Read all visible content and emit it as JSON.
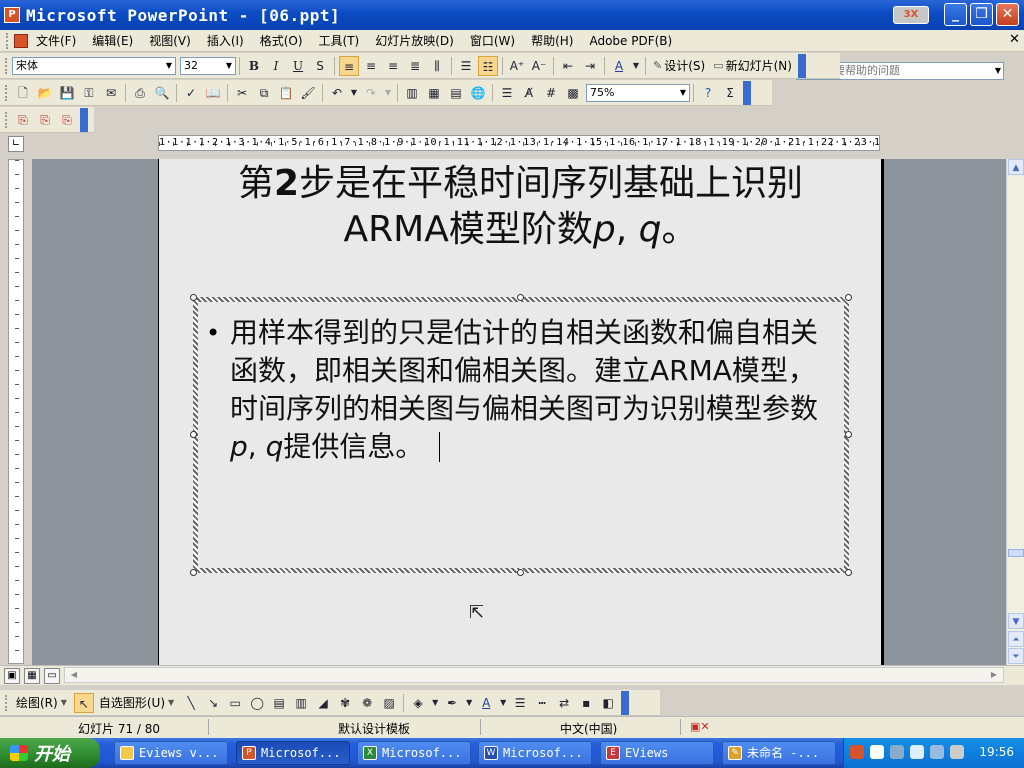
{
  "window": {
    "title": "Microsoft PowerPoint - [06.ppt]",
    "badge": "3X"
  },
  "menu": {
    "items": [
      "文件(F)",
      "编辑(E)",
      "视图(V)",
      "插入(I)",
      "格式(O)",
      "工具(T)",
      "幻灯片放映(D)",
      "窗口(W)",
      "帮助(H)",
      "Adobe PDF(B)"
    ],
    "help_placeholder": "键入需要帮助的问题"
  },
  "format_toolbar": {
    "font": "宋体",
    "size": "32",
    "design_label": "设计(S)",
    "new_slide_label": "新幻灯片(N)"
  },
  "standard_toolbar": {
    "zoom": "75%"
  },
  "ruler": {
    "numbers": "1·1·1·1·2·1·3·1·4·1·5·1·6·1·7·1·8·1·9·1·10·1·11·1·12·1·13·1·14·1·15·1·16·1·17·1·18·1·19·1·20·1·21·1·22·1·23·1"
  },
  "slide": {
    "title_line1_pre": "第",
    "title_line1_num": "2",
    "title_line1_post": "步是在平稳时间序列基础上识别",
    "title_line2_pre": "ARMA模型阶数",
    "title_p": "p",
    "title_sep": ", ",
    "title_q": "q",
    "title_end": "。",
    "bullet": "•",
    "body_part1": "用样本得到的只是估计的自相关函数和偏自相关函数，即相关图和偏相关图。建立ARMA模型，时间序列的相关图与偏相关图可为识别模型参数",
    "body_p": "p",
    "body_sep": ", ",
    "body_q": "q",
    "body_part2": "提供信息。"
  },
  "draw_toolbar": {
    "draw_label": "绘图(R)",
    "autoshape_label": "自选图形(U)"
  },
  "status": {
    "slide_pos": "幻灯片 71 / 80",
    "template": "默认设计模板",
    "language": "中文(中国)"
  },
  "taskbar": {
    "start_label": "开始",
    "tasks": [
      "Eviews v...",
      "Microsof...",
      "Microsof...",
      "Microsof...",
      "EViews",
      "未命名 -..."
    ],
    "clock": "19:56"
  }
}
